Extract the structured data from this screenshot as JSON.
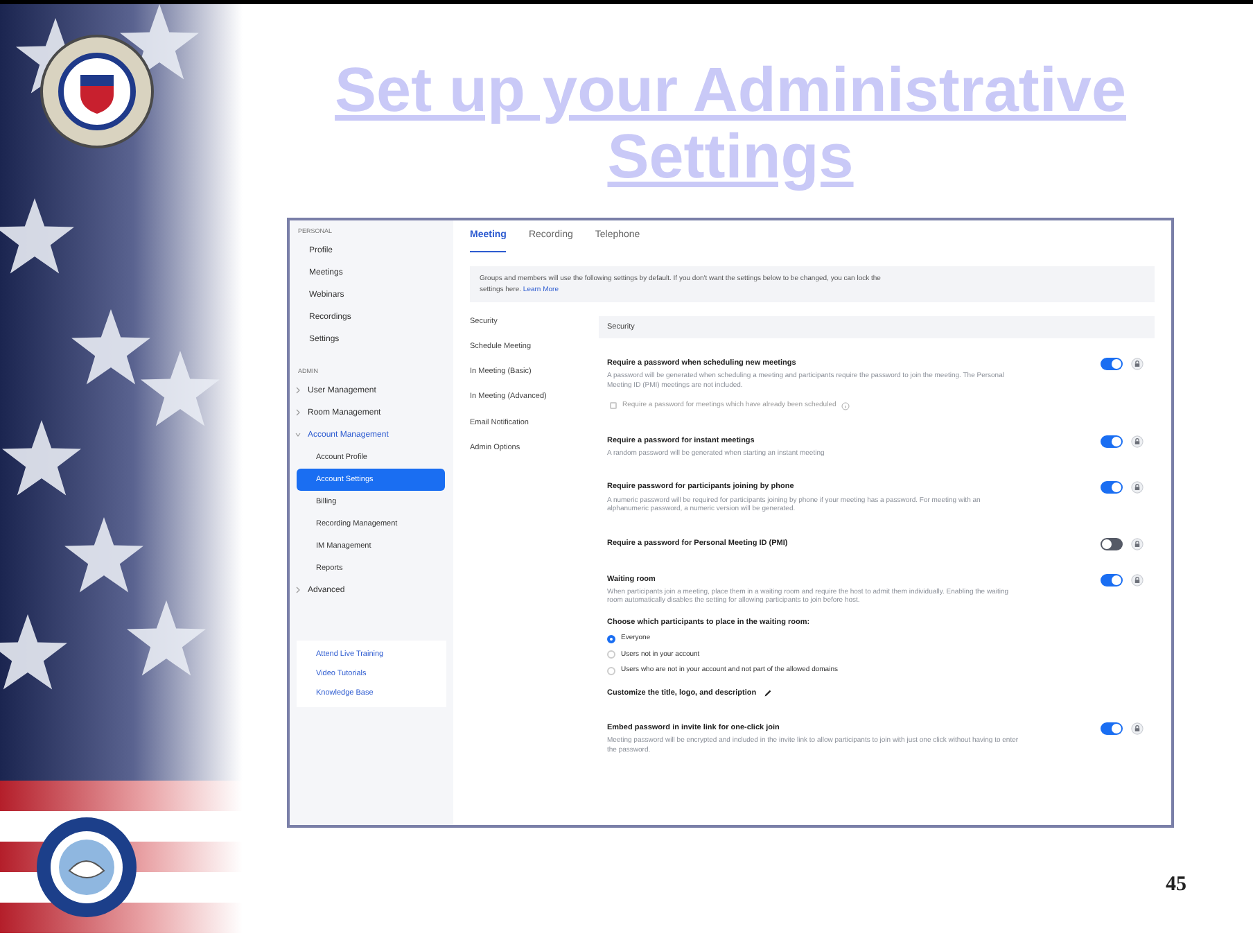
{
  "slide": {
    "title": "Set up your Administrative Settings",
    "page_number": "45"
  },
  "sidebar": {
    "sections": [
      {
        "heading": "PERSONAL",
        "items": [
          {
            "label": "Profile",
            "selected": false
          },
          {
            "label": "Meetings",
            "selected": false
          },
          {
            "label": "Webinars",
            "selected": false
          },
          {
            "label": "Recordings",
            "selected": false
          },
          {
            "label": "Settings",
            "selected": false
          }
        ]
      },
      {
        "heading": "ADMIN",
        "items": [
          {
            "label": "User Management",
            "selected": false,
            "expanded": false
          },
          {
            "label": "Room Management",
            "selected": false,
            "expanded": false
          },
          {
            "label": "Account Management",
            "selected": false,
            "expanded": true,
            "children": [
              {
                "label": "Account Profile",
                "selected": false
              },
              {
                "label": "Account Settings",
                "selected": true
              },
              {
                "label": "Billing",
                "selected": false
              },
              {
                "label": "Recording Management",
                "selected": false
              },
              {
                "label": "IM Management",
                "selected": false
              },
              {
                "label": "Reports",
                "selected": false
              }
            ]
          },
          {
            "label": "Advanced",
            "selected": false,
            "expanded": false
          }
        ]
      }
    ],
    "links": [
      "Attend Live Training",
      "Video Tutorials",
      "Knowledge Base"
    ]
  },
  "tabs": [
    {
      "label": "Meeting",
      "selected": true
    },
    {
      "label": "Recording",
      "selected": false
    },
    {
      "label": "Telephone",
      "selected": false
    }
  ],
  "notice": {
    "text": "Groups and members will use the following settings by default. If you don't want the settings below to be changed, you can lock the settings here.",
    "link": "Learn More"
  },
  "section_nav": [
    "Security",
    "Schedule Meeting",
    "In Meeting (Basic)",
    "In Meeting (Advanced)",
    "Email Notification",
    "Admin Options"
  ],
  "section_heading": "Security",
  "settings": [
    {
      "title": "Require a password when scheduling new meetings",
      "description": "A password will be generated when scheduling a meeting and participants require the password to join the meeting. The Personal Meeting ID (PMI) meetings are not included.",
      "on": true,
      "sub_checkbox": {
        "label": "Require a password for meetings which have already been scheduled",
        "checked": false
      }
    },
    {
      "title": "Require a password for instant meetings",
      "description": "A random password will be generated when starting an instant meeting",
      "on": true
    },
    {
      "title": "Require password for participants joining by phone",
      "description": "A numeric password will be required for participants joining by phone if your meeting has a password. For meeting with an alphanumeric password, a numeric version will be generated.",
      "on": true
    },
    {
      "title": "Require a password for Personal Meeting ID (PMI)",
      "on": false
    },
    {
      "title": "Waiting room",
      "description": "When participants join a meeting, place them in a waiting room and require the host to admit them individually. Enabling the waiting room automatically disables the setting for allowing participants to join before host.",
      "on": true,
      "radio_group": {
        "label": "Choose which participants to place in the waiting room:",
        "options": [
          {
            "label": "Everyone",
            "selected": true
          },
          {
            "label": "Users not in your account",
            "selected": false
          },
          {
            "label": "Users who are not in your account and not part of the allowed domains",
            "selected": false
          }
        ]
      },
      "customize": "Customize the title, logo, and description"
    },
    {
      "title": "Embed password in invite link for one-click join",
      "description": "Meeting password will be encrypted and included in the invite link to allow participants to join with just one click without having to enter the password.",
      "on": true
    }
  ]
}
